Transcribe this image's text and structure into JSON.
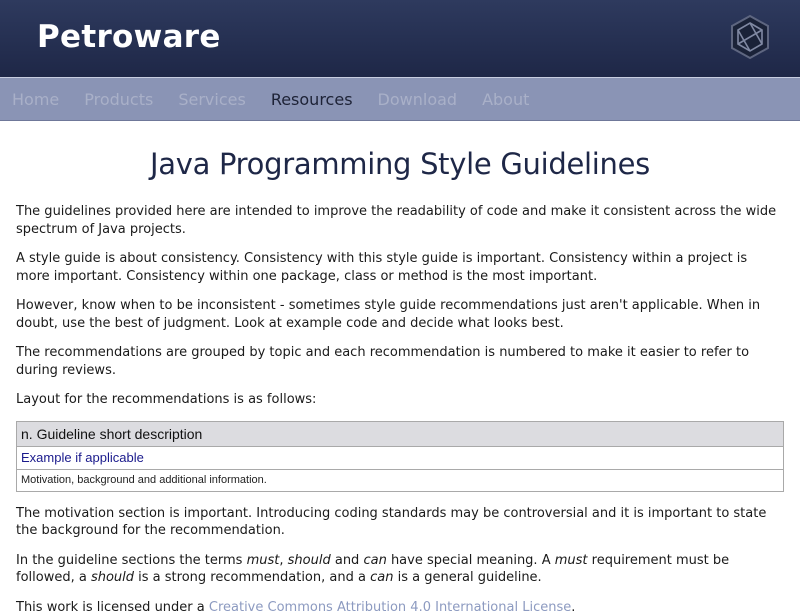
{
  "header": {
    "brand": "Petroware",
    "logo_icon": "hexagon-logo-icon"
  },
  "nav": {
    "items": [
      {
        "label": "Home",
        "active": false
      },
      {
        "label": "Products",
        "active": false
      },
      {
        "label": "Services",
        "active": false
      },
      {
        "label": "Resources",
        "active": true
      },
      {
        "label": "Download",
        "active": false
      },
      {
        "label": "About",
        "active": false
      }
    ]
  },
  "main": {
    "title": "Java Programming Style Guidelines",
    "p1": "The guidelines provided here are intended to improve the readability of code and make it consistent across the wide spectrum of Java projects.",
    "p2": "A style guide is about consistency. Consistency with this style guide is important. Consistency within a project is more important. Consistency within one package, class or method is the most important.",
    "p3": "However, know when to be inconsistent - sometimes style guide recommendations just aren't applicable. When in doubt, use the best of judgment. Look at example code and decide what looks best.",
    "p4": "The recommendations are grouped by topic and each recommendation is numbered to make it easier to refer to during reviews.",
    "p5": "Layout for the recommendations is as follows:",
    "table": {
      "heading": "n. Guideline short description",
      "example": "Example if applicable",
      "motivation": "Motivation, background and additional information."
    },
    "p6": "The motivation section is important. Introducing coding standards may be controversial and it is important to state the background for the recommendation.",
    "p7": {
      "t1": "In the guideline sections the terms ",
      "must": "must",
      "t2": ", ",
      "should": "should",
      "t3": " and ",
      "can": "can",
      "t4": " have special meaning. A ",
      "must2": "must",
      "t5": " requirement must be followed, a ",
      "should2": "should",
      "t6": " is a strong recommendation, and a ",
      "can2": "can",
      "t7": " is a general guideline."
    },
    "p8": {
      "t1": "This work is licensed under a ",
      "link": "Creative Commons Attribution 4.0 International License",
      "t2": "."
    }
  },
  "colors": {
    "header_bg": "#1e2747",
    "nav_bg": "#8a94b5",
    "title": "#1e2747",
    "link": "#8c9ac0"
  }
}
